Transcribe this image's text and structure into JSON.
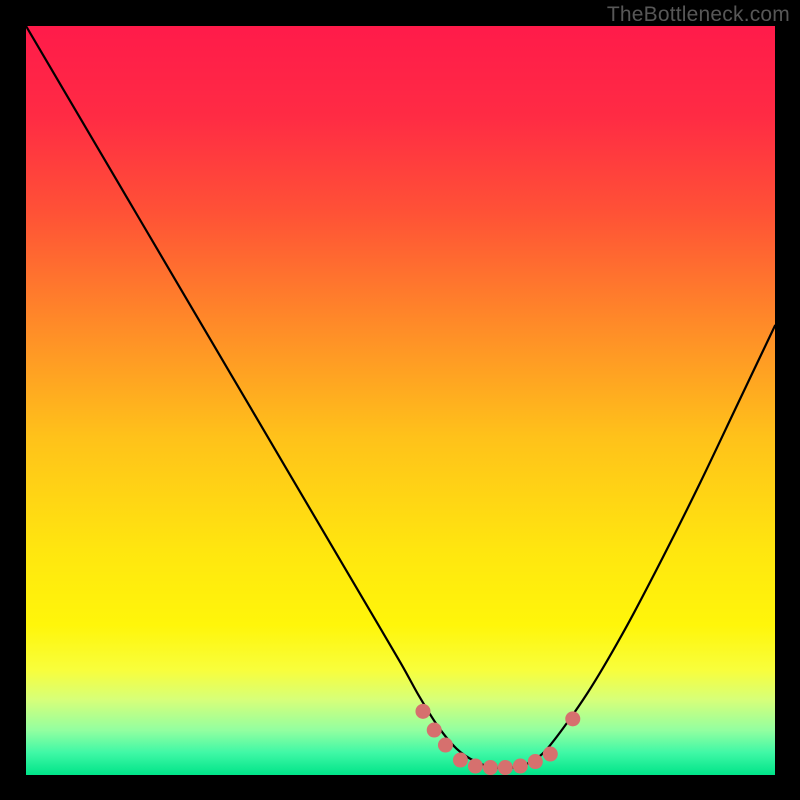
{
  "watermark": "TheBottleneck.com",
  "gradient_stops": [
    {
      "offset": 0.0,
      "color": "#ff1b4a"
    },
    {
      "offset": 0.12,
      "color": "#ff2b44"
    },
    {
      "offset": 0.25,
      "color": "#ff5236"
    },
    {
      "offset": 0.4,
      "color": "#ff8b28"
    },
    {
      "offset": 0.55,
      "color": "#ffc21a"
    },
    {
      "offset": 0.7,
      "color": "#ffe60f"
    },
    {
      "offset": 0.8,
      "color": "#fff60a"
    },
    {
      "offset": 0.86,
      "color": "#f8fe3c"
    },
    {
      "offset": 0.9,
      "color": "#d6ff7a"
    },
    {
      "offset": 0.94,
      "color": "#93ffa0"
    },
    {
      "offset": 0.97,
      "color": "#40f8a6"
    },
    {
      "offset": 1.0,
      "color": "#00e489"
    }
  ],
  "chart_data": {
    "type": "line",
    "title": "",
    "xlabel": "",
    "ylabel": "",
    "xlim": [
      0,
      1
    ],
    "ylim": [
      0,
      1
    ],
    "series": [
      {
        "name": "bottleneck-curve",
        "x": [
          0.0,
          0.05,
          0.1,
          0.15,
          0.2,
          0.25,
          0.3,
          0.35,
          0.4,
          0.45,
          0.5,
          0.525,
          0.55,
          0.575,
          0.6,
          0.625,
          0.65,
          0.675,
          0.7,
          0.75,
          0.8,
          0.85,
          0.9,
          0.95,
          1.0
        ],
        "y": [
          1.0,
          0.915,
          0.83,
          0.745,
          0.66,
          0.575,
          0.49,
          0.405,
          0.32,
          0.235,
          0.15,
          0.105,
          0.065,
          0.035,
          0.018,
          0.01,
          0.01,
          0.018,
          0.04,
          0.11,
          0.195,
          0.29,
          0.39,
          0.495,
          0.6
        ]
      }
    ],
    "markers": {
      "name": "highlight-cluster",
      "color": "#d6706e",
      "points": [
        {
          "x": 0.53,
          "y": 0.085
        },
        {
          "x": 0.545,
          "y": 0.06
        },
        {
          "x": 0.56,
          "y": 0.04
        },
        {
          "x": 0.58,
          "y": 0.02
        },
        {
          "x": 0.6,
          "y": 0.012
        },
        {
          "x": 0.62,
          "y": 0.01
        },
        {
          "x": 0.64,
          "y": 0.01
        },
        {
          "x": 0.66,
          "y": 0.012
        },
        {
          "x": 0.68,
          "y": 0.018
        },
        {
          "x": 0.7,
          "y": 0.028
        },
        {
          "x": 0.73,
          "y": 0.075
        }
      ]
    }
  }
}
